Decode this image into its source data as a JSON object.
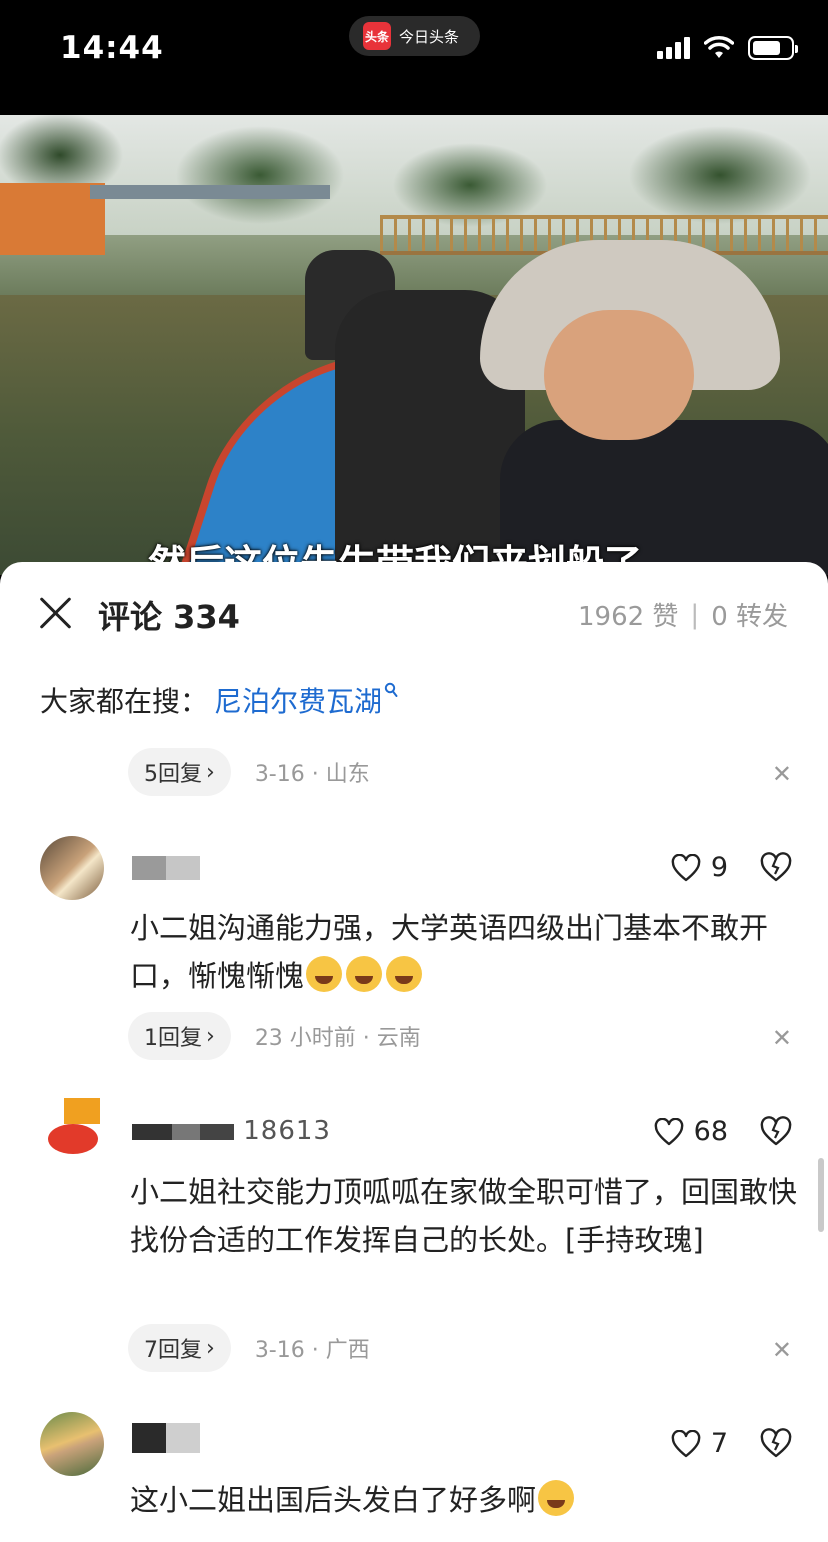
{
  "status_bar": {
    "time": "14:44",
    "app_badge": "头条",
    "app_name": "今日头条",
    "battery_level": 0.75
  },
  "video": {
    "subtitle": "然后这位先生带我们来划船了"
  },
  "header": {
    "title": "评论 334",
    "likes": "1962 赞",
    "separator": "|",
    "shares": "0 转发"
  },
  "hot_search": {
    "label": "大家都在搜：",
    "term": "尼泊尔费瓦湖"
  },
  "top_reply_row": {
    "replies": "5回复",
    "meta": "3-16 · 山东"
  },
  "comments": [
    {
      "username": "",
      "likes": "9",
      "text": "小二姐沟通能力强，大学英语四级出门基本不敢开口，惭愧惭愧",
      "replies": "1回复",
      "meta": "23 小时前 · 云南"
    },
    {
      "username": "",
      "username_visible": "18613",
      "likes": "68",
      "text": "小二姐社交能力顶呱呱在家做全职可惜了，回国敢快找份合适的工作发挥自己的长处。[手持玫瑰]",
      "replies": "7回复",
      "meta": "3-16 · 广西"
    },
    {
      "username": "",
      "likes": "7",
      "text": "这小二姐出国后头发白了好多啊"
    }
  ],
  "icons": {
    "close": "close-icon",
    "like": "heart-outline-icon",
    "dislike": "broken-heart-icon",
    "search": "search-icon",
    "chevron": "chevron-right-icon",
    "dismiss": "close-small-icon"
  },
  "colors": {
    "link": "#1e6bd0",
    "muted": "#999999",
    "text": "#222222"
  }
}
